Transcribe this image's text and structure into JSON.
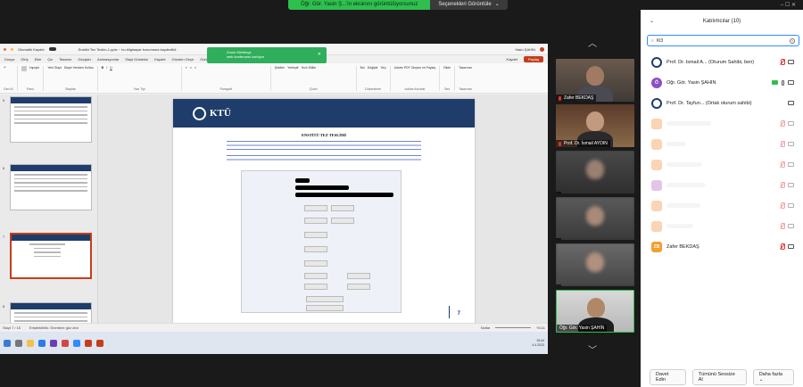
{
  "share_banner": {
    "text": "Öğr. Gör. Yasin Ş...'in ekranını görüntülüyorsunuz",
    "options_label": "Seçenekleri Görüntüle",
    "options_chevron": "⌄",
    "window_buttons": "– ☐ ✕"
  },
  "ppt": {
    "autosave_label": "Otomatik Kaydet",
    "file_title": "Enstitü Tez Teslim-1.pptx ~ bu bilgisayar konumuna kaydedildi",
    "user": "Yasin ŞAHİN",
    "menu": [
      "Dosya",
      "Giriş",
      "Ekle",
      "Çiz",
      "Tasarım",
      "Geçişler",
      "Animasyonlar",
      "Slayt Gösterisi",
      "Kaydet",
      "Gözden Geçir",
      "Görünüm",
      "Yardım",
      "Acrobat"
    ],
    "save_label": "Kaydet",
    "share_label": "Paylaş",
    "ribbon_groups": [
      {
        "label": "Geri Al",
        "items": [
          "↶"
        ]
      },
      {
        "label": "Pano",
        "items": [
          "Yapıştır"
        ]
      },
      {
        "label": "Slaytlar",
        "items": [
          "Yeni Slayt",
          "Slaytı Yeniden Kullan"
        ]
      },
      {
        "label": "Yazı Tipi",
        "items": [
          "B",
          "I",
          "U"
        ]
      },
      {
        "label": "Paragraf",
        "items": [
          "≡",
          "≡",
          "≡"
        ]
      },
      {
        "label": "Çizim",
        "items": [
          "Şekiller",
          "Yerleştir",
          "Hızlı Stiller"
        ]
      },
      {
        "label": "Düzenleme",
        "items": [
          "Bul",
          "Değiştir",
          "Seç"
        ]
      },
      {
        "label": "Adobe Acrobat",
        "items": [
          "Adobe PDF Oluştur ve Paylaş"
        ]
      },
      {
        "label": "Ses",
        "items": [
          "Dikte"
        ]
      },
      {
        "label": "Tasarımcı",
        "items": [
          "Tasarımcı"
        ]
      }
    ],
    "thumb_numbers": [
      "5",
      "6",
      "7",
      "8"
    ],
    "slide": {
      "logo_text": "KTÜ",
      "title": "ENSTİTÜ TEZ TESLİMİ",
      "number": "7"
    },
    "status": {
      "slide_info": "Slayt 7 / 15",
      "accessibility": "Erişilebilirlik: Önerilere göz atın",
      "notes": "Notlar",
      "zoom": "%111"
    },
    "clock": {
      "time": "15:44",
      "date": "4.4.2023"
    }
  },
  "toast": {
    "line1": "Zoom Meetings",
    "line2": "web konferansı katılıyor"
  },
  "videos": [
    {
      "name": "Zafer BEKDAŞ"
    },
    {
      "name": "Prof. Dr. İsmail AYDIN"
    },
    {
      "name": ""
    },
    {
      "name": ""
    },
    {
      "name": ""
    },
    {
      "name": "Öğr. Gör. Yasin ŞAHİN"
    }
  ],
  "panel": {
    "title": "Katılımcılar (10)",
    "collapse_icon": "⌄",
    "search_value": "Kt3",
    "participants": [
      {
        "name": "Prof. Dr. İsmail A...  (Oturum Sahibi, ben)",
        "avatar_letter": "",
        "avatar_color": "#1f3d6b"
      },
      {
        "name": "Öğr. Gör. Yasin ŞAHİN",
        "avatar_letter": "Ö",
        "avatar_color": "#8e4ec6"
      },
      {
        "name": "Prof. Dr. Tayfun...  (Ortak oturum sahibi)",
        "avatar_letter": "",
        "avatar_color": "#1f3d6b"
      },
      {
        "name": "",
        "avatar_letter": "",
        "avatar_color": "#f5a15a"
      },
      {
        "name": "",
        "avatar_letter": "",
        "avatar_color": "#f5a15a"
      },
      {
        "name": "",
        "avatar_letter": "",
        "avatar_color": "#f5a15a"
      },
      {
        "name": "",
        "avatar_letter": "",
        "avatar_color": "#c77dd1"
      },
      {
        "name": "",
        "avatar_letter": "",
        "avatar_color": "#f5a15a"
      },
      {
        "name": "",
        "avatar_letter": "",
        "avatar_color": "#f5a15a"
      },
      {
        "name": "Zafer BEKDAŞ",
        "avatar_letter": "ZB",
        "avatar_color": "#f2a02e"
      }
    ],
    "footer": {
      "invite": "Davet Edin",
      "mute_all": "Tümünü Sessize Al",
      "more": "Daha fazla"
    }
  }
}
